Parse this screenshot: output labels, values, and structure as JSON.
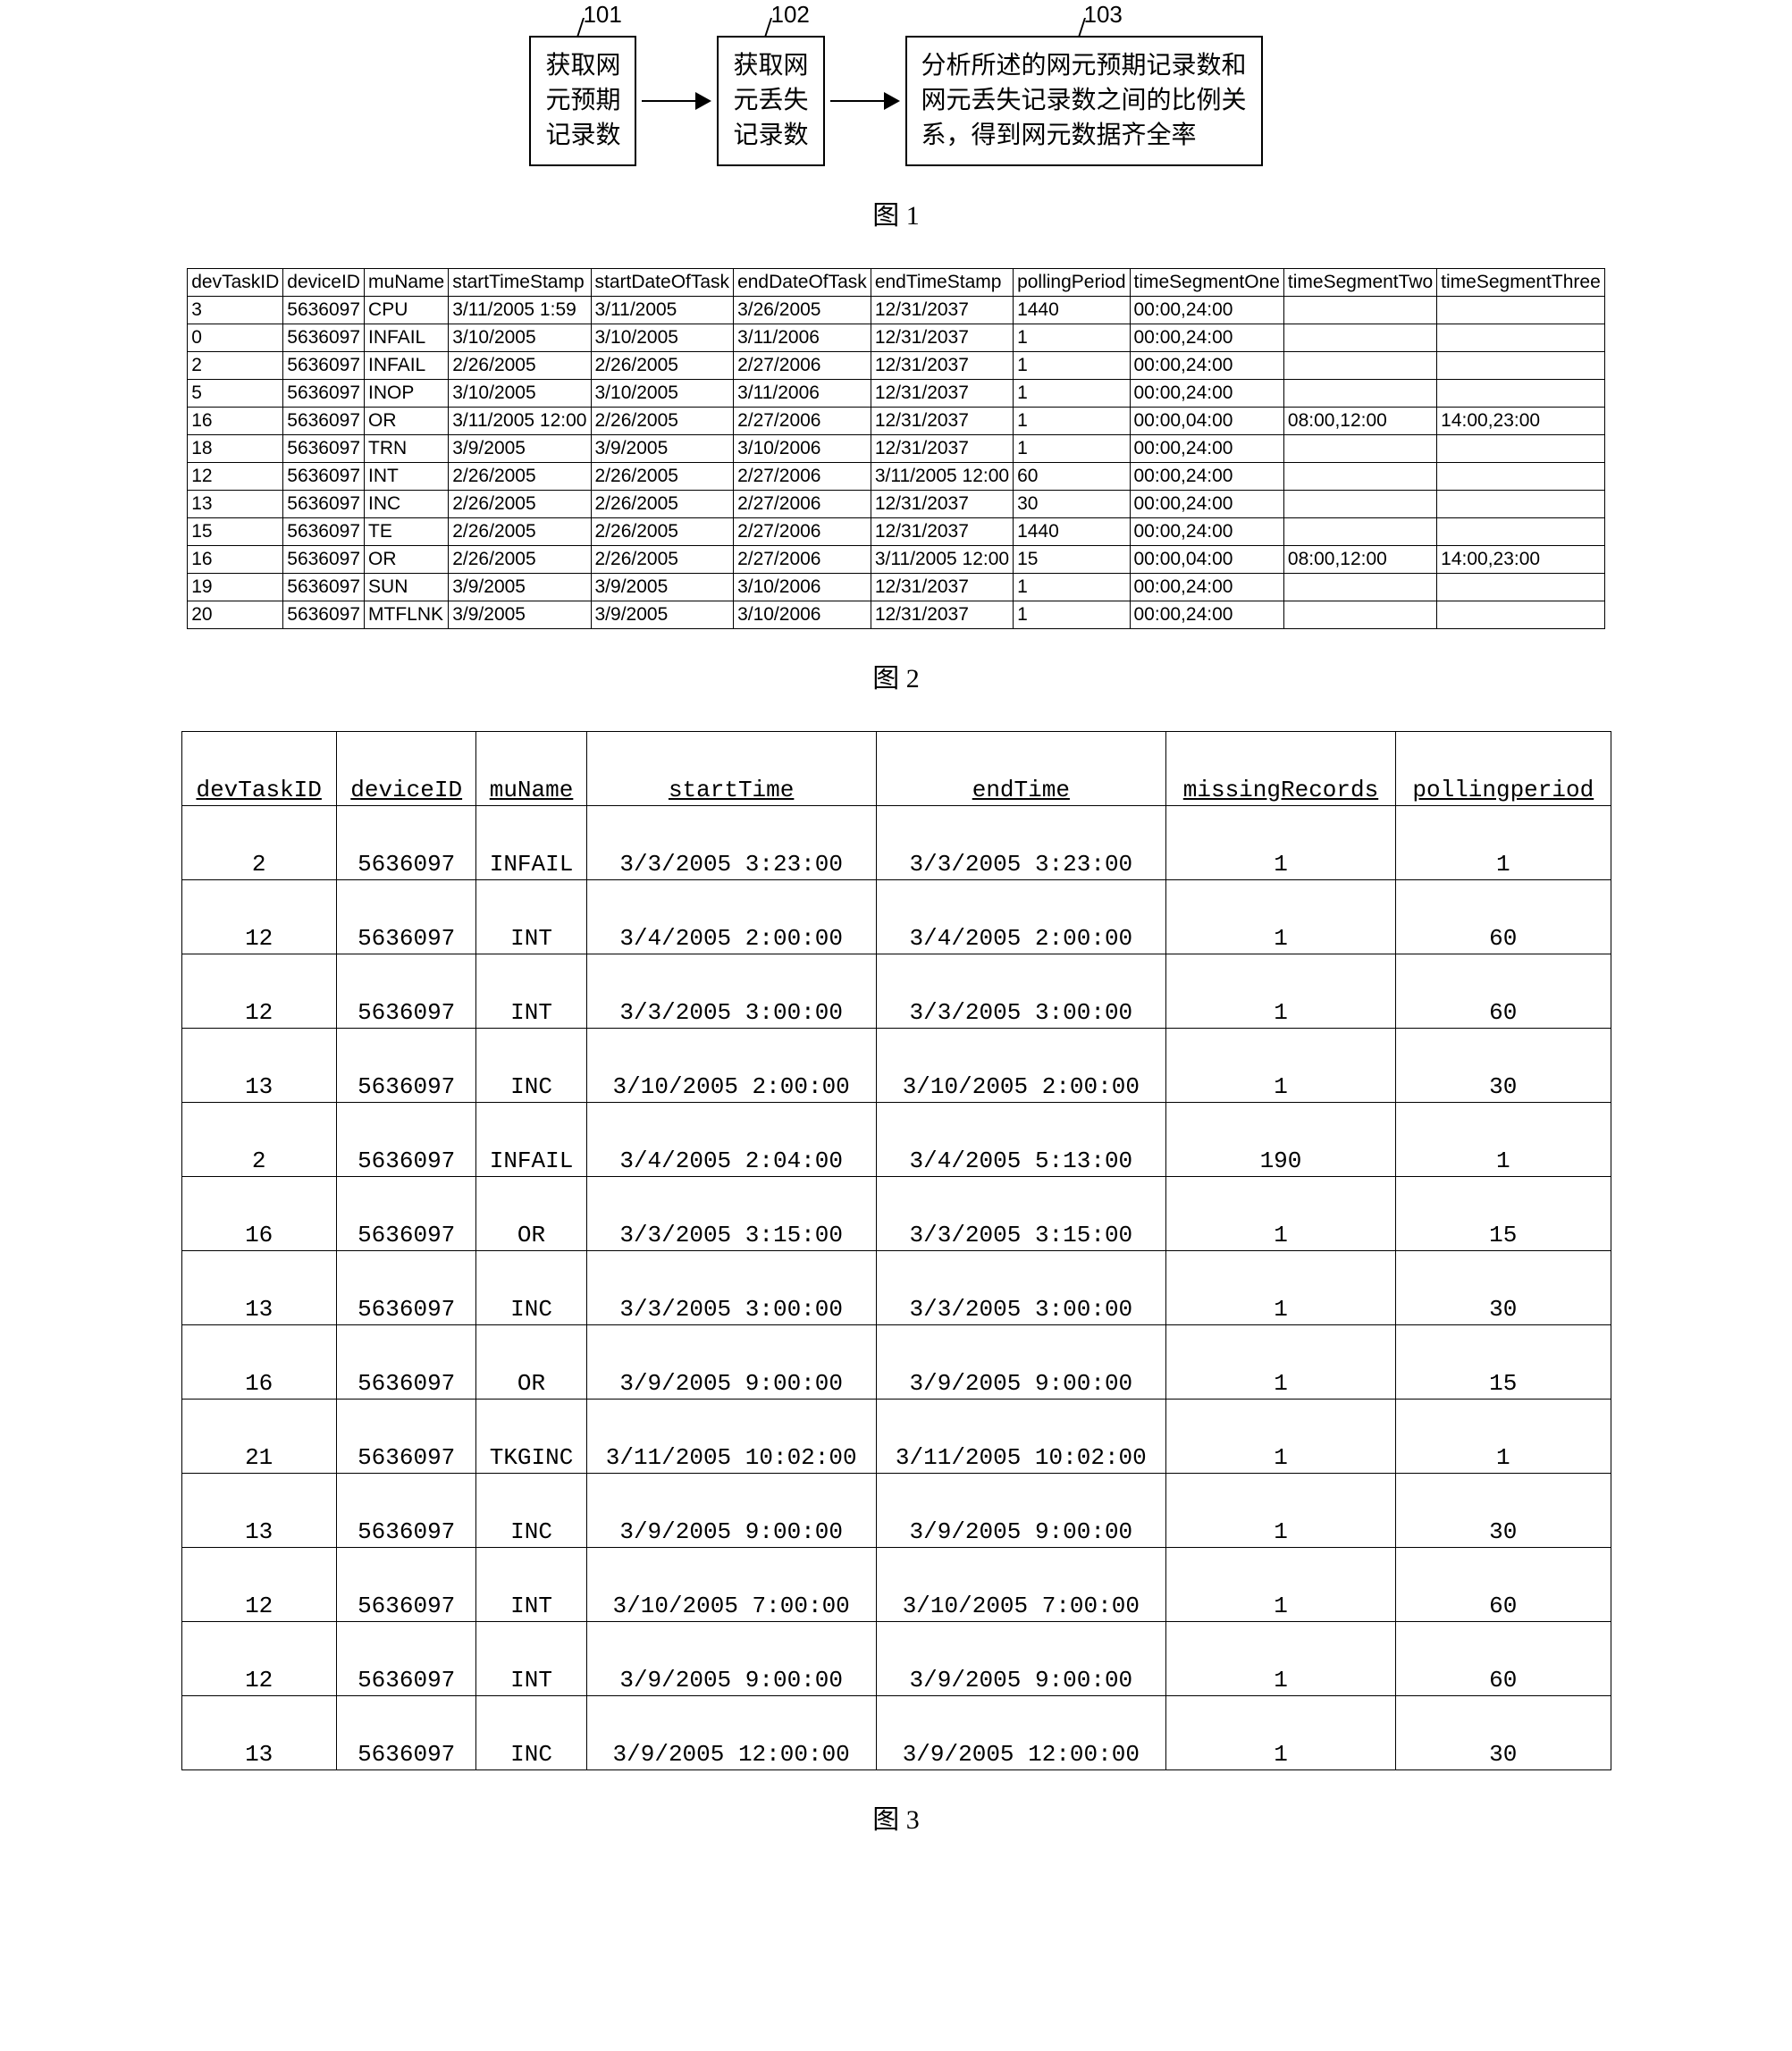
{
  "fig1": {
    "box1": {
      "label": "101",
      "line1": "获取网",
      "line2": "元预期",
      "line3": "记录数"
    },
    "box2": {
      "label": "102",
      "line1": "获取网",
      "line2": "元丢失",
      "line3": "记录数"
    },
    "box3": {
      "label": "103",
      "line1": "分析所述的网元预期记录数和",
      "line2": "网元丢失记录数之间的比例关",
      "line3": "系，得到网元数据齐全率"
    },
    "caption": "图 1"
  },
  "fig2": {
    "headers": [
      "devTaskID",
      "deviceID",
      "muName",
      "startTimeStamp",
      "startDateOfTask",
      "endDateOfTask",
      "endTimeStamp",
      "pollingPeriod",
      "timeSegmentOne",
      "timeSegmentTwo",
      "timeSegmentThree"
    ],
    "rows": [
      [
        "3",
        "5636097",
        "CPU",
        "3/11/2005 1:59",
        "3/11/2005",
        "3/26/2005",
        "12/31/2037",
        "1440",
        "00:00,24:00",
        "",
        ""
      ],
      [
        "0",
        "5636097",
        "INFAIL",
        "3/10/2005",
        "3/10/2005",
        "3/11/2006",
        "12/31/2037",
        "1",
        "00:00,24:00",
        "",
        ""
      ],
      [
        "2",
        "5636097",
        "INFAIL",
        "2/26/2005",
        "2/26/2005",
        "2/27/2006",
        "12/31/2037",
        "1",
        "00:00,24:00",
        "",
        ""
      ],
      [
        "5",
        "5636097",
        "INOP",
        "3/10/2005",
        "3/10/2005",
        "3/11/2006",
        "12/31/2037",
        "1",
        "00:00,24:00",
        "",
        ""
      ],
      [
        "16",
        "5636097",
        "OR",
        "3/11/2005 12:00",
        "2/26/2005",
        "2/27/2006",
        "12/31/2037",
        "1",
        "00:00,04:00",
        "08:00,12:00",
        "14:00,23:00"
      ],
      [
        "18",
        "5636097",
        "TRN",
        "3/9/2005",
        "3/9/2005",
        "3/10/2006",
        "12/31/2037",
        "1",
        "00:00,24:00",
        "",
        ""
      ],
      [
        "12",
        "5636097",
        "INT",
        "2/26/2005",
        "2/26/2005",
        "2/27/2006",
        "3/11/2005 12:00",
        "60",
        "00:00,24:00",
        "",
        ""
      ],
      [
        "13",
        "5636097",
        "INC",
        "2/26/2005",
        "2/26/2005",
        "2/27/2006",
        "12/31/2037",
        "30",
        "00:00,24:00",
        "",
        ""
      ],
      [
        "15",
        "5636097",
        "TE",
        "2/26/2005",
        "2/26/2005",
        "2/27/2006",
        "12/31/2037",
        "1440",
        "00:00,24:00",
        "",
        ""
      ],
      [
        "16",
        "5636097",
        "OR",
        "2/26/2005",
        "2/26/2005",
        "2/27/2006",
        "3/11/2005 12:00",
        "15",
        "00:00,04:00",
        "08:00,12:00",
        "14:00,23:00"
      ],
      [
        "19",
        "5636097",
        "SUN",
        "3/9/2005",
        "3/9/2005",
        "3/10/2006",
        "12/31/2037",
        "1",
        "00:00,24:00",
        "",
        ""
      ],
      [
        "20",
        "5636097",
        "MTFLNK",
        "3/9/2005",
        "3/9/2005",
        "3/10/2006",
        "12/31/2037",
        "1",
        "00:00,24:00",
        "",
        ""
      ]
    ],
    "caption": "图 2"
  },
  "fig3": {
    "headers": [
      "devTaskID",
      "deviceID",
      "muName",
      "startTime",
      "endTime",
      "missingRecords",
      "pollingperiod"
    ],
    "rows": [
      [
        "2",
        "5636097",
        "INFAIL",
        "3/3/2005 3:23:00",
        "3/3/2005 3:23:00",
        "1",
        "1"
      ],
      [
        "12",
        "5636097",
        "INT",
        "3/4/2005 2:00:00",
        "3/4/2005 2:00:00",
        "1",
        "60"
      ],
      [
        "12",
        "5636097",
        "INT",
        "3/3/2005 3:00:00",
        "3/3/2005 3:00:00",
        "1",
        "60"
      ],
      [
        "13",
        "5636097",
        "INC",
        "3/10/2005 2:00:00",
        "3/10/2005 2:00:00",
        "1",
        "30"
      ],
      [
        "2",
        "5636097",
        "INFAIL",
        "3/4/2005 2:04:00",
        "3/4/2005 5:13:00",
        "190",
        "1"
      ],
      [
        "16",
        "5636097",
        "OR",
        "3/3/2005 3:15:00",
        "3/3/2005 3:15:00",
        "1",
        "15"
      ],
      [
        "13",
        "5636097",
        "INC",
        "3/3/2005 3:00:00",
        "3/3/2005 3:00:00",
        "1",
        "30"
      ],
      [
        "16",
        "5636097",
        "OR",
        "3/9/2005 9:00:00",
        "3/9/2005 9:00:00",
        "1",
        "15"
      ],
      [
        "21",
        "5636097",
        "TKGINC",
        "3/11/2005 10:02:00",
        "3/11/2005 10:02:00",
        "1",
        "1"
      ],
      [
        "13",
        "5636097",
        "INC",
        "3/9/2005 9:00:00",
        "3/9/2005 9:00:00",
        "1",
        "30"
      ],
      [
        "12",
        "5636097",
        "INT",
        "3/10/2005 7:00:00",
        "3/10/2005 7:00:00",
        "1",
        "60"
      ],
      [
        "12",
        "5636097",
        "INT",
        "3/9/2005 9:00:00",
        "3/9/2005 9:00:00",
        "1",
        "60"
      ],
      [
        "13",
        "5636097",
        "INC",
        "3/9/2005 12:00:00",
        "3/9/2005 12:00:00",
        "1",
        "30"
      ]
    ],
    "caption": "图 3"
  }
}
